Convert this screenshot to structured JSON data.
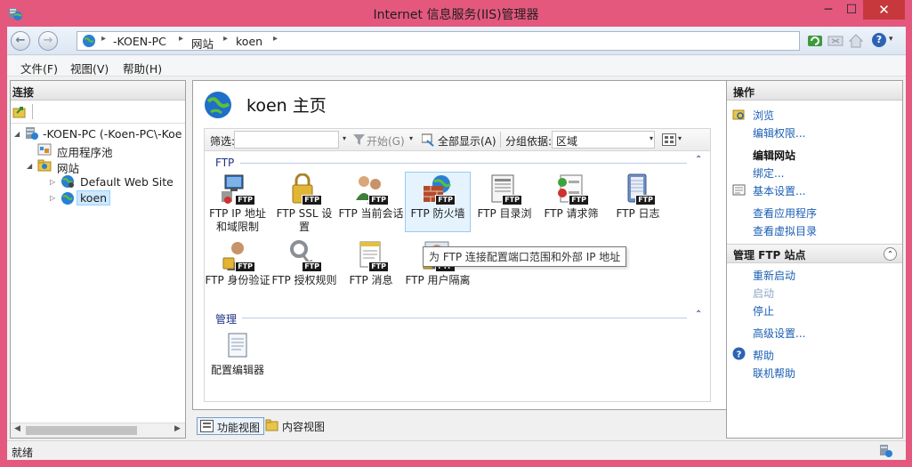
{
  "window": {
    "title": "Internet 信息服务(IIS)管理器",
    "minimize": "─",
    "maximize": "☐",
    "close": "✕"
  },
  "address": {
    "crumbs": [
      "-KOEN-PC",
      "网站",
      "koen"
    ],
    "separator": "▸",
    "help": "?",
    "help_drop": "▾"
  },
  "nav": {
    "back": "←",
    "forward": "→"
  },
  "menu": [
    "文件(F)",
    "视图(V)",
    "帮助(H)"
  ],
  "connections": {
    "header": "连接",
    "tree": [
      {
        "label": "-KOEN-PC (-Koen-PC\\-Koe",
        "toggle": "◢",
        "icon": "server-icon"
      },
      {
        "label": "应用程序池",
        "toggle": "",
        "icon": "app-pool-icon"
      },
      {
        "label": "网站",
        "toggle": "◢",
        "icon": "sites-folder-icon"
      },
      {
        "label": "Default Web Site",
        "toggle": "▷",
        "icon": "globe-icon"
      },
      {
        "label": "koen",
        "toggle": "▷",
        "icon": "globe-icon",
        "selected": true
      }
    ],
    "scroll_left": "◀",
    "scroll_right": "▶"
  },
  "page": {
    "title": "koen 主页",
    "filter_label": "筛选:",
    "start_label": "开始(G)",
    "show_all_label": "全部显示(A)",
    "group_by_label": "分组依据:",
    "group_by_value": "区域",
    "dropdown": "▾",
    "groups": [
      {
        "name": "FTP",
        "collapse": "⌃",
        "features": [
          {
            "label": "FTP IP 地址和域限制",
            "icon": "ip-restriction-icon"
          },
          {
            "label": "FTP SSL 设置",
            "icon": "ssl-lock-icon"
          },
          {
            "label": "FTP 当前会话",
            "icon": "sessions-icon"
          },
          {
            "label": "FTP 防火墙",
            "icon": "firewall-icon",
            "selected": true
          },
          {
            "label": "FTP 目录浏",
            "icon": "directory-browsing-icon"
          },
          {
            "label": "FTP 请求筛",
            "icon": "request-filtering-icon"
          },
          {
            "label": "FTP 日志",
            "icon": "logging-icon"
          },
          {
            "label": "FTP 身份验证",
            "icon": "authentication-icon"
          },
          {
            "label": "FTP 授权规则",
            "icon": "authorization-key-icon"
          },
          {
            "label": "FTP 消息",
            "icon": "messages-icon"
          },
          {
            "label": "FTP 用户隔离",
            "icon": "user-isolation-icon"
          }
        ]
      },
      {
        "name": "管理",
        "collapse": "⌃",
        "features": [
          {
            "label": "配置编辑器",
            "icon": "config-editor-icon"
          }
        ]
      }
    ],
    "ftp_tag": "FTP",
    "tooltip": "为 FTP 连接配置端口范围和外部 IP 地址"
  },
  "view_tabs": [
    "功能视图",
    "内容视图"
  ],
  "actions": {
    "header": "操作",
    "items": [
      {
        "label": "浏览",
        "style": "link",
        "icon": "explore-icon"
      },
      {
        "label": "编辑权限...",
        "style": "link"
      },
      {
        "label": "编辑网站",
        "style": "heading"
      },
      {
        "label": "绑定...",
        "style": "link"
      },
      {
        "label": "基本设置...",
        "style": "link",
        "icon": "settings-icon"
      },
      {
        "label": "查看应用程序",
        "style": "link"
      },
      {
        "label": "查看虚拟目录",
        "style": "link"
      }
    ],
    "ftp_section": {
      "header": "管理 FTP 站点",
      "collapse": "⌃",
      "items": [
        {
          "label": "重新启动",
          "style": "link"
        },
        {
          "label": "启动",
          "style": "disabled"
        },
        {
          "label": "停止",
          "style": "link"
        },
        {
          "label": "高级设置...",
          "style": "link"
        },
        {
          "label": "帮助",
          "style": "link",
          "icon": "help-icon"
        },
        {
          "label": "联机帮助",
          "style": "link"
        }
      ]
    }
  },
  "status": {
    "text": "就绪"
  },
  "colors": {
    "title_bar": "#e4587e",
    "close_button": "#c7383d",
    "link": "#1a5fb4",
    "group_header": "#1e3287",
    "selection": "#cde8ff"
  }
}
